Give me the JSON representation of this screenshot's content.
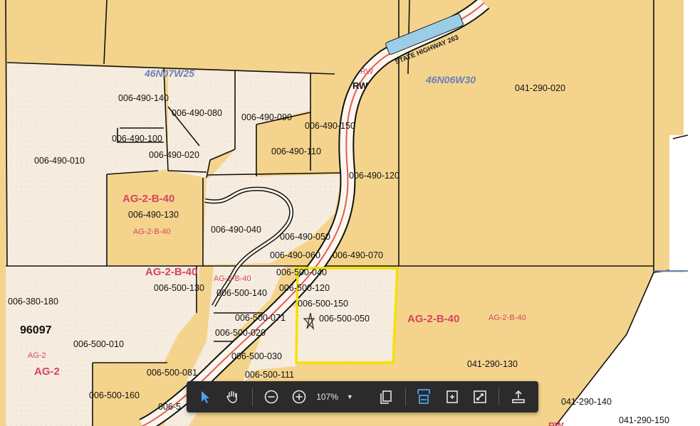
{
  "map": {
    "sections": [
      "46N07W25",
      "46N06W30"
    ],
    "highway": "STATE HIGHWAY 263",
    "rw_labels": [
      "RW",
      "RW",
      "RW"
    ],
    "parcels": [
      "006-490-140",
      "006-490-080",
      "006-490-090",
      "006-490-150",
      "006-490-100",
      "006-490-010",
      "006-490-020",
      "006-490-110",
      "006-490-120",
      "006-490-130",
      "006-490-040",
      "006-490-050",
      "006-490-060",
      "006-490-070",
      "006-500-040",
      "006-500-130",
      "006-500-140",
      "006-500-120",
      "006-380-180",
      "006-500-150",
      "006-500-050",
      "006-500-071",
      "006-500-020",
      "006-500-010",
      "006-500-030",
      "006-500-081",
      "006-500-111",
      "006-500-160",
      "006-5",
      "041-290-020",
      "041-290-130",
      "041-290-140",
      "041-290-150",
      "96097"
    ],
    "zones": [
      "AG-2-B-40",
      "AG-2-B-40",
      "AG-2-B-40",
      "AG-2-B-40",
      "AG-2-B-40",
      "AG-2-B-40",
      "AG-2",
      "AG-2"
    ]
  },
  "toolbar": {
    "zoom": "107%",
    "tools": [
      "select-tool",
      "hand-tool",
      "zoom-out",
      "zoom-in",
      "zoom-dropdown",
      "page-view",
      "fit-width",
      "rotate",
      "fullscreen",
      "share"
    ]
  },
  "colors": {
    "parcel_tan": "#f4d48c",
    "parcel_light": "#f6ede0",
    "road_red": "#e45a5a",
    "zone_label": "#d64560",
    "section_label": "#6a7fb8",
    "selection": "#f5e100",
    "toolbar_bg": "#2b2b2b",
    "tool_active": "#4aa3f0"
  }
}
